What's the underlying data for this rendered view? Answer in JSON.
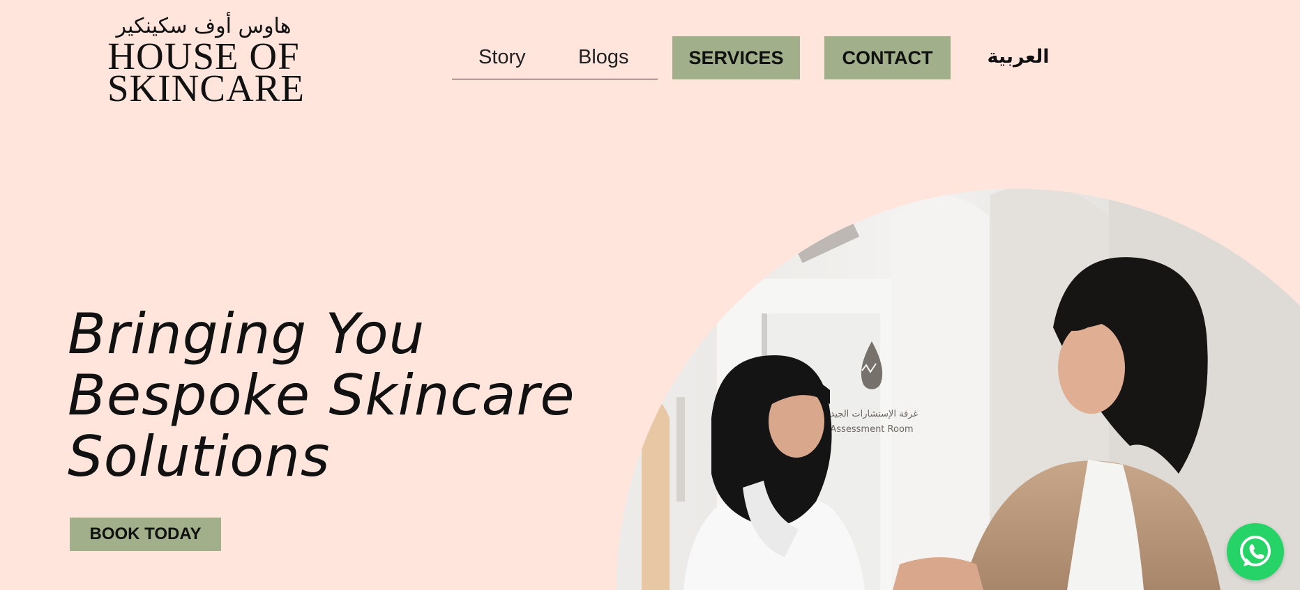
{
  "brand": {
    "arabic_name": "هاوس أوف سكينكير",
    "name_line1": "HOUSE OF",
    "name_line2": "SKINCARE"
  },
  "nav": {
    "story": "Story",
    "blogs": "Blogs",
    "services": "SERVICES",
    "contact": "CONTACT",
    "language": "العربية"
  },
  "hero": {
    "title_line1": "Bringing You",
    "title_line2": "Bespoke Skincare",
    "title_line3": "Solutions",
    "cta": "BOOK TODAY",
    "image_alt": "Dermatologist greeting a client at the clinic",
    "sign_arabic": "غرفة الإستشارات الجيدة",
    "sign_english": "Assessment Room"
  },
  "floating": {
    "whatsapp_icon": "whatsapp-icon"
  },
  "colors": {
    "background": "#ffe5dc",
    "accent_green": "#a1b08b",
    "whatsapp_green": "#25d366",
    "text": "#111111"
  }
}
